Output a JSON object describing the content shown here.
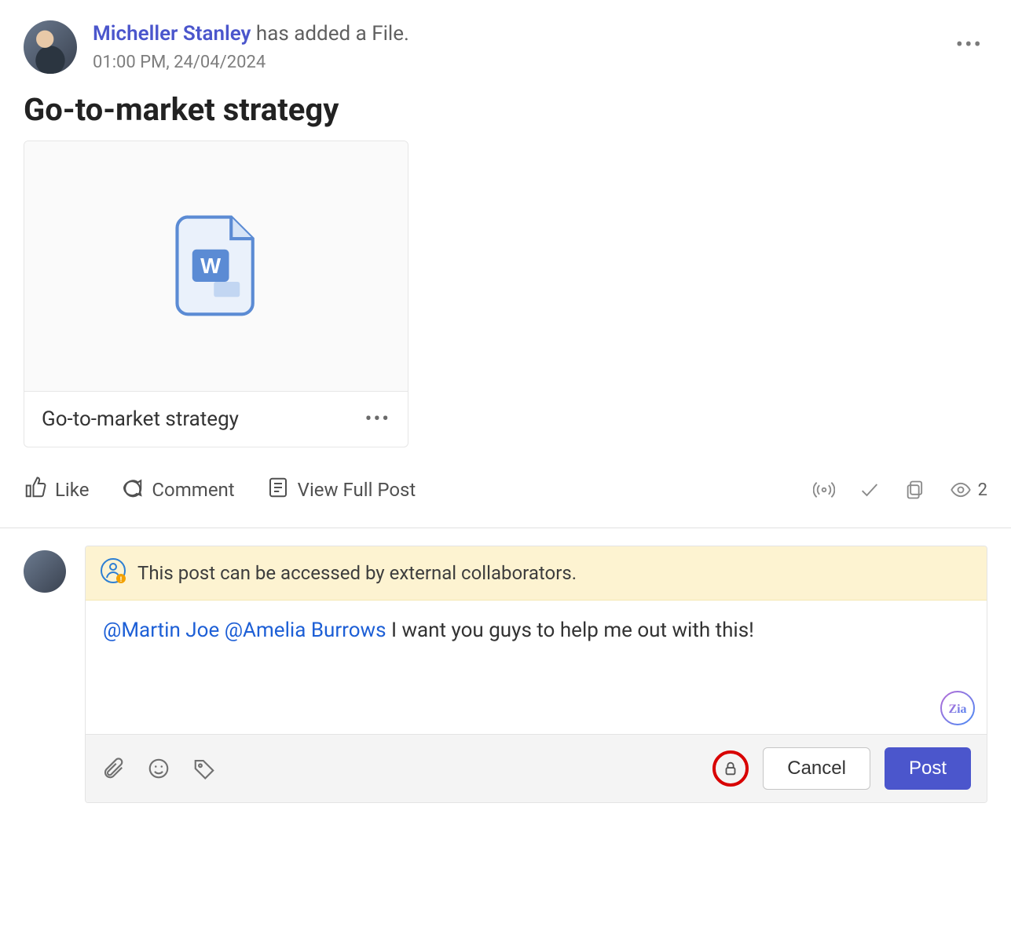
{
  "post": {
    "author": "Micheller Stanley",
    "action_text": "has added a File.",
    "timestamp": "01:00 PM, 24/04/2024",
    "heading": "Go-to-market strategy"
  },
  "file": {
    "name": "Go-to-market strategy"
  },
  "actions": {
    "like": "Like",
    "comment": "Comment",
    "view_full": "View Full Post",
    "views_count": "2"
  },
  "composer": {
    "notice": "This post can be accessed by external collaborators.",
    "mention1": "@Martin Joe",
    "mention2": "@Amelia Burrows",
    "message_rest": " I want you guys to help me out with this!",
    "cancel_label": "Cancel",
    "post_label": "Post"
  }
}
